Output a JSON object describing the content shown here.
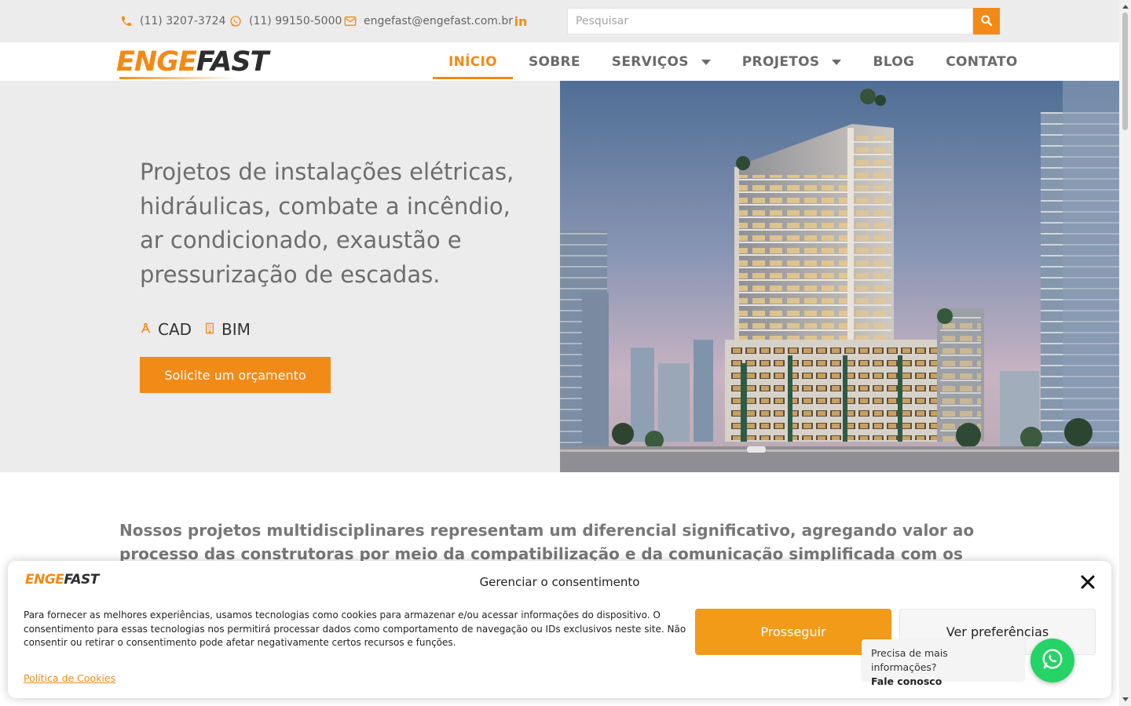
{
  "topbar": {
    "phone1": "(11) 3207-3724",
    "phone2": "(11) 99150-5000",
    "email": "engefast@engefast.com.br",
    "linkedin_icon": "linkedin-icon",
    "search_placeholder": "Pesquisar"
  },
  "header": {
    "logo_part1": "ENGE",
    "logo_part2": "FAST",
    "nav": [
      "INÍCIO",
      "SOBRE",
      "SERVIÇOS",
      "PROJETOS",
      "BLOG",
      "CONTATO"
    ],
    "active_item": "INÍCIO"
  },
  "hero": {
    "title": "Projetos de instalações elétricas, hidráulicas, combate a incêndio, ar condicionado, exaustão e pressurização de escadas.",
    "tag1": "CAD",
    "tag2": "BIM",
    "cta_label": "Solicite um orçamento"
  },
  "intro": {
    "text": "Nossos projetos multidisciplinares representam um diferencial significativo, agregando valor ao processo das construtoras por meio da compatibilização e da comunicação simplificada com os profissionais da"
  },
  "consent": {
    "logo_part1": "ENGE",
    "logo_part2": "FAST",
    "title": "Gerenciar o consentimento",
    "body": "Para fornecer as melhores experiências, usamos tecnologias como cookies para armazenar e/ou acessar informações do dispositivo. O consentimento para essas tecnologias nos permitirá processar dados como comportamento de navegação ou IDs exclusivos neste site. Não consentir ou retirar o consentimento pode afetar negativamente certos recursos e funções.",
    "accept_label": "Prosseguir",
    "prefs_label": "Ver preferências",
    "policy_link": "Política de Cookies"
  },
  "whatsapp": {
    "line1": "Precisa de mais informações?",
    "line2": "Fale conosco"
  },
  "colors": {
    "accent": "#f28a17",
    "consent_accept": "#f29b18",
    "whatsapp": "#25d366",
    "hero_bg": "#ececec"
  }
}
